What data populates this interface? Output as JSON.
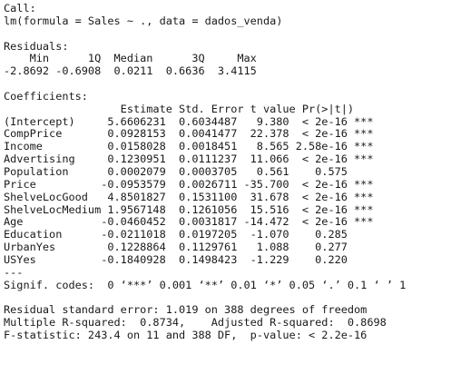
{
  "console": {
    "lines": [
      "Call:",
      "lm(formula = Sales ~ ., data = dados_venda)",
      "",
      "Residuals:",
      "    Min      1Q  Median      3Q     Max ",
      "-2.8692 -0.6908  0.0211  0.6636  3.4115 ",
      "",
      "Coefficients:",
      "                  Estimate Std. Error t value Pr(>|t|)    ",
      "(Intercept)     5.6606231  0.6034487   9.380  < 2e-16 ***",
      "CompPrice       0.0928153  0.0041477  22.378  < 2e-16 ***",
      "Income          0.0158028  0.0018451   8.565 2.58e-16 ***",
      "Advertising     0.1230951  0.0111237  11.066  < 2e-16 ***",
      "Population      0.0002079  0.0003705   0.561    0.575    ",
      "Price          -0.0953579  0.0026711 -35.700  < 2e-16 ***",
      "ShelveLocGood   4.8501827  0.1531100  31.678  < 2e-16 ***",
      "ShelveLocMedium 1.9567148  0.1261056  15.516  < 2e-16 ***",
      "Age            -0.0460452  0.0031817 -14.472  < 2e-16 ***",
      "Education      -0.0211018  0.0197205  -1.070    0.285    ",
      "UrbanYes        0.1228864  0.1129761   1.088    0.277    ",
      "USYes          -0.1840928  0.1498423  -1.229    0.220    ",
      "---",
      "Signif. codes:  0 ‘***’ 0.001 ‘**’ 0.01 ‘*’ 0.05 ‘.’ 0.1 ‘ ’ 1",
      "",
      "Residual standard error: 1.019 on 388 degrees of freedom",
      "Multiple R-squared:  0.8734,\tAdjusted R-squared:  0.8698 ",
      "F-statistic: 243.4 on 11 and 388 DF,  p-value: < 2.2e-16"
    ]
  }
}
